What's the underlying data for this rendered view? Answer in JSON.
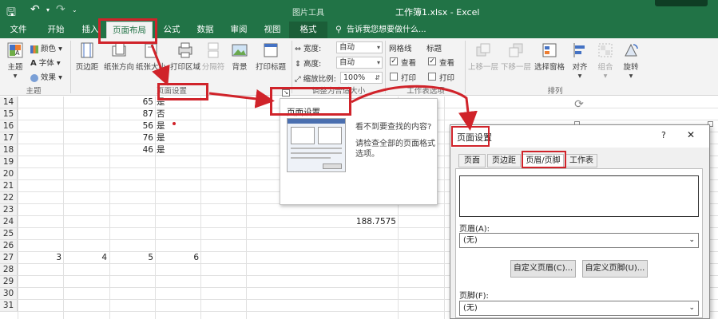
{
  "window": {
    "title": "工作簿1.xlsx - Excel",
    "context_tab_header": "图片工具"
  },
  "tabs": [
    {
      "label": "文件"
    },
    {
      "label": "开始"
    },
    {
      "label": "插入"
    },
    {
      "label": "页面布局"
    },
    {
      "label": "公式"
    },
    {
      "label": "数据"
    },
    {
      "label": "审阅"
    },
    {
      "label": "视图"
    },
    {
      "label": "格式"
    }
  ],
  "tell_me": "告诉我您想要做什么...",
  "ribbon": {
    "theme": {
      "main": "主题",
      "colors": "颜色",
      "fonts": "字体",
      "effects": "效果",
      "group": "主题"
    },
    "page_setup": {
      "margins": "页边距",
      "orientation": "纸张方向",
      "size": "纸张大小",
      "print_area": "打印区域",
      "breaks": "分隔符",
      "background": "背景",
      "print_titles": "打印标题",
      "group": "页面设置"
    },
    "scale": {
      "width_label": "宽度:",
      "width_value": "自动",
      "height_label": "高度:",
      "height_value": "自动",
      "scale_label": "缩放比例:",
      "scale_value": "100%",
      "group": "调整为合适大小"
    },
    "sheet_options": {
      "gridlines": "网格线",
      "headings": "标题",
      "view1": "查看",
      "view2": "查看",
      "print1": "打印",
      "print2": "打印",
      "group": "工作表选项"
    },
    "arrange": {
      "bring_forward": "上移一层",
      "send_backward": "下移一层",
      "selection_pane": "选择窗格",
      "align": "对齐",
      "group_btn": "组合",
      "rotate": "旋转",
      "group": "排列"
    }
  },
  "sheet": {
    "row_numbers": [
      "14",
      "15",
      "16",
      "17",
      "18",
      "19",
      "20",
      "21",
      "22",
      "23",
      "24",
      "25",
      "26",
      "27",
      "28",
      "29",
      "30",
      "31"
    ],
    "cells": [
      {
        "row": "14",
        "num": "65",
        "text": "是"
      },
      {
        "row": "15",
        "num": "87",
        "text": "否"
      },
      {
        "row": "16",
        "num": "56",
        "text": "是"
      },
      {
        "row": "17",
        "num": "76",
        "text": "是"
      },
      {
        "row": "18",
        "num": "46",
        "text": "是"
      }
    ],
    "value_24": "188.7575",
    "row27": [
      "3",
      "4",
      "5",
      "6"
    ]
  },
  "popup": {
    "title": "页面设置",
    "line1": "看不到要查找的内容?",
    "line2": "请检查全部的页面格式选项。"
  },
  "dialog": {
    "title": "页面设置",
    "help": "?",
    "close": "✕",
    "tabs": [
      "页面",
      "页边距",
      "页眉/页脚",
      "工作表"
    ],
    "header_label": "页眉(A):",
    "header_value": "(无)",
    "custom_header": "自定义页眉(C)...",
    "custom_footer": "自定义页脚(U)...",
    "footer_label": "页脚(F):",
    "footer_value": "(无)"
  },
  "colors": {
    "excel_green": "#217346",
    "annotation_red": "#d0232a"
  }
}
